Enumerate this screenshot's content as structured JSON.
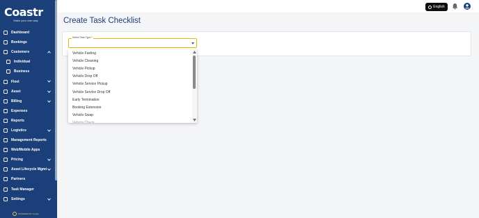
{
  "brand": {
    "name": "Coastr",
    "tagline": "Make your own way"
  },
  "topbar": {
    "language_label": "English",
    "language_icon": "globe-icon",
    "notification_icon": "bell-icon",
    "account_icon": "user-circle-icon"
  },
  "sidebar": {
    "items": [
      {
        "label": "Dashboard",
        "icon": "dashboard-icon",
        "expandable": false,
        "sub": false
      },
      {
        "label": "Bookings",
        "icon": "bookings-icon",
        "expandable": false,
        "sub": false
      },
      {
        "label": "Customers",
        "icon": "customers-icon",
        "expandable": true,
        "expanded": true,
        "sub": false
      },
      {
        "label": "Individual",
        "icon": "person-icon",
        "expandable": false,
        "sub": true
      },
      {
        "label": "Business",
        "icon": "building-icon",
        "expandable": false,
        "sub": true
      },
      {
        "label": "Fleet",
        "icon": "car-icon",
        "expandable": true,
        "sub": false
      },
      {
        "label": "Asset",
        "icon": "asset-icon",
        "expandable": true,
        "sub": false
      },
      {
        "label": "Billing",
        "icon": "billing-icon",
        "expandable": true,
        "sub": false
      },
      {
        "label": "Expenses",
        "icon": "expenses-icon",
        "expandable": false,
        "sub": false
      },
      {
        "label": "Reports",
        "icon": "reports-icon",
        "expandable": false,
        "sub": false
      },
      {
        "label": "Logistics",
        "icon": "truck-icon",
        "expandable": true,
        "sub": false
      },
      {
        "label": "Management Reports",
        "icon": "management-reports-icon",
        "expandable": false,
        "sub": false
      },
      {
        "label": "Web/Mobile Apps",
        "icon": "apps-icon",
        "expandable": false,
        "sub": false
      },
      {
        "label": "Pricing",
        "icon": "tag-icon",
        "expandable": true,
        "sub": false
      },
      {
        "label": "Asset Lifecycle Mgmt",
        "icon": "lifecycle-icon",
        "expandable": true,
        "sub": false
      },
      {
        "label": "Partners",
        "icon": "partners-icon",
        "expandable": false,
        "sub": false
      },
      {
        "label": "Task Manager",
        "icon": "task-icon",
        "expandable": false,
        "sub": false
      },
      {
        "label": "Settings",
        "icon": "gear-icon",
        "expandable": true,
        "sub": false
      }
    ],
    "powered_by": "POWERED BY Coastr"
  },
  "main": {
    "title": "Create Task Checklist",
    "select": {
      "label": "Select Task Type *",
      "value": ""
    },
    "dropdown_options": [
      "Vehicle Fueling",
      "Vehicle Cleaning",
      "Vehicle Pickup",
      "Vehicle Drop Off",
      "Vehicle Service Pickup",
      "Vehicle Service Drop Off",
      "Early Termination",
      "Booking Extension",
      "Vehicle Swap",
      "Vehicle Check"
    ]
  },
  "colors": {
    "sidebar": "#1b3f78",
    "accent": "#e6b800",
    "title": "#1b3f78"
  }
}
